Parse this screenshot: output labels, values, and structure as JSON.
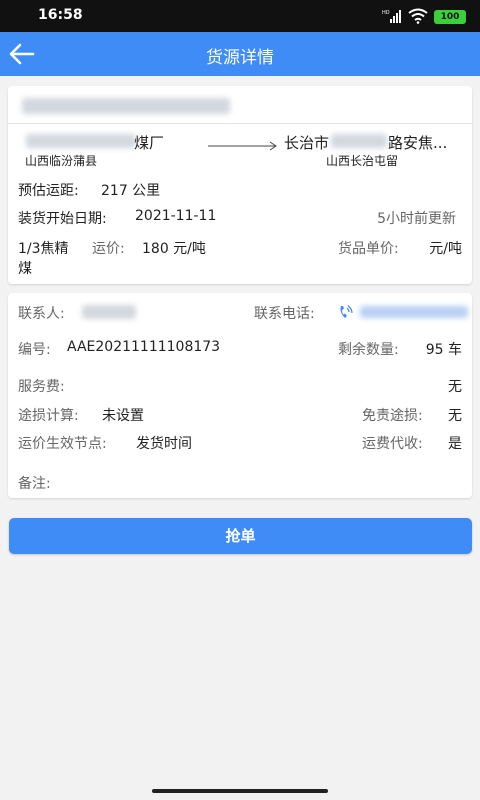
{
  "status": {
    "time": "16:58",
    "hd_label": "HD",
    "battery": "100"
  },
  "header": {
    "title": "货源详情"
  },
  "route": {
    "origin_name_suffix": "煤厂",
    "origin_region": "山西临汾蒲县",
    "dest_name_prefix": "长治市",
    "dest_name_suffix": "路安焦...",
    "dest_region": "山西长治屯留"
  },
  "info": {
    "distance_label": "预估运距:",
    "distance_value": "217 公里",
    "load_date_label": "装货开始日期:",
    "load_date_value": "2021-11-11",
    "updated": "5小时前更新",
    "cargo_line1": "1/3焦精",
    "cargo_line2": "煤",
    "freight_label": "运价:",
    "freight_value": "180 元/吨",
    "unit_price_label": "货品单价:",
    "unit_price_value": "元/吨"
  },
  "details": {
    "contact_label": "联系人:",
    "phone_label": "联系电话:",
    "code_label": "编号:",
    "code_value": "AAE20211111108173",
    "remaining_label": "剩余数量:",
    "remaining_value": "95 车",
    "service_fee_label": "服务费:",
    "service_fee_value": "无",
    "loss_calc_label": "途损计算:",
    "loss_calc_value": "未设置",
    "free_loss_label": "免责途损:",
    "free_loss_value": "无",
    "effective_node_label": "运价生效节点:",
    "effective_node_value": "发货时间",
    "collect_label": "运费代收:",
    "collect_value": "是",
    "remark_label": "备注:"
  },
  "actions": {
    "grab_label": "抢单"
  },
  "colors": {
    "primary": "#3f8cf7",
    "status_bar": "#111111",
    "battery": "#3ccf3c"
  }
}
